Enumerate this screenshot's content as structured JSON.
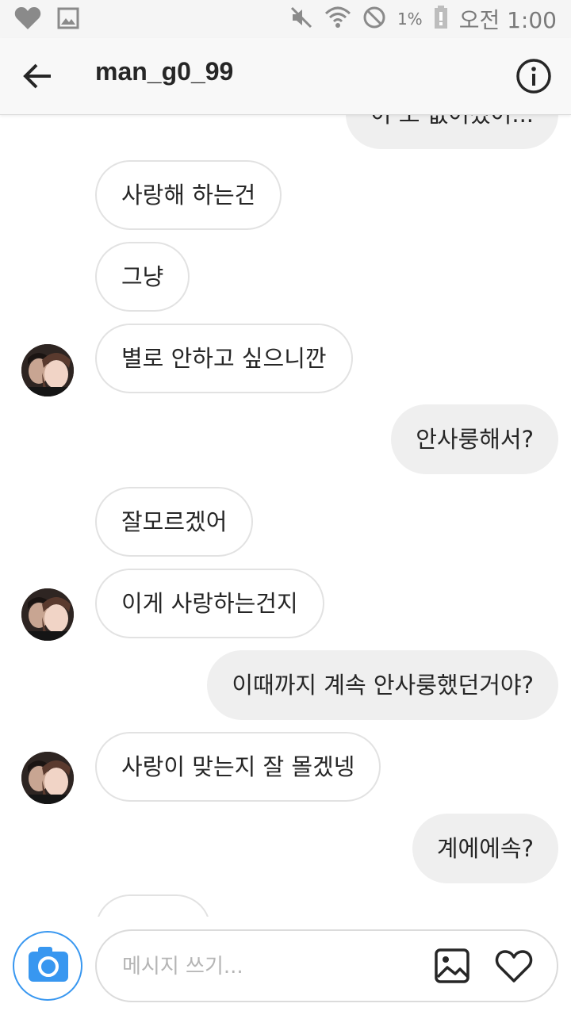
{
  "status_bar": {
    "battery_percent": "1%",
    "time": "오전 1:00",
    "icons": [
      "heart-icon",
      "image-icon",
      "mute-icon",
      "wifi-icon",
      "blocked-icon",
      "battery-icon"
    ]
  },
  "header": {
    "title": "man_g0_99",
    "back_icon": "arrow-left-icon",
    "info_icon": "info-icon"
  },
  "messages": [
    {
      "side": "out",
      "text": "이 도 없어졌어..."
    },
    {
      "side": "in",
      "text": "사랑해 하는건"
    },
    {
      "side": "in",
      "text": "그냥"
    },
    {
      "side": "in",
      "text": "별로 안하고 싶으니깐"
    },
    {
      "side": "out",
      "text": "안사룽해서?"
    },
    {
      "side": "in",
      "text": "잘모르겠어"
    },
    {
      "side": "in",
      "text": "이게 사랑하는건지"
    },
    {
      "side": "out",
      "text": "이때까지 계속 안사룽했던거야?"
    },
    {
      "side": "in",
      "text": "사랑이 맞는지 잘 몰겠넹"
    },
    {
      "side": "out",
      "text": "계에에속?"
    },
    {
      "side": "in",
      "text": ""
    }
  ],
  "composer": {
    "placeholder": "메시지 쓰기...",
    "camera_icon": "camera-icon",
    "gallery_icon": "gallery-icon",
    "like_icon": "heart-outline-icon"
  },
  "colors": {
    "accent": "#3897f0",
    "outgoing_bubble": "#efefef",
    "incoming_border": "#e2e2e2",
    "text": "#262626"
  }
}
